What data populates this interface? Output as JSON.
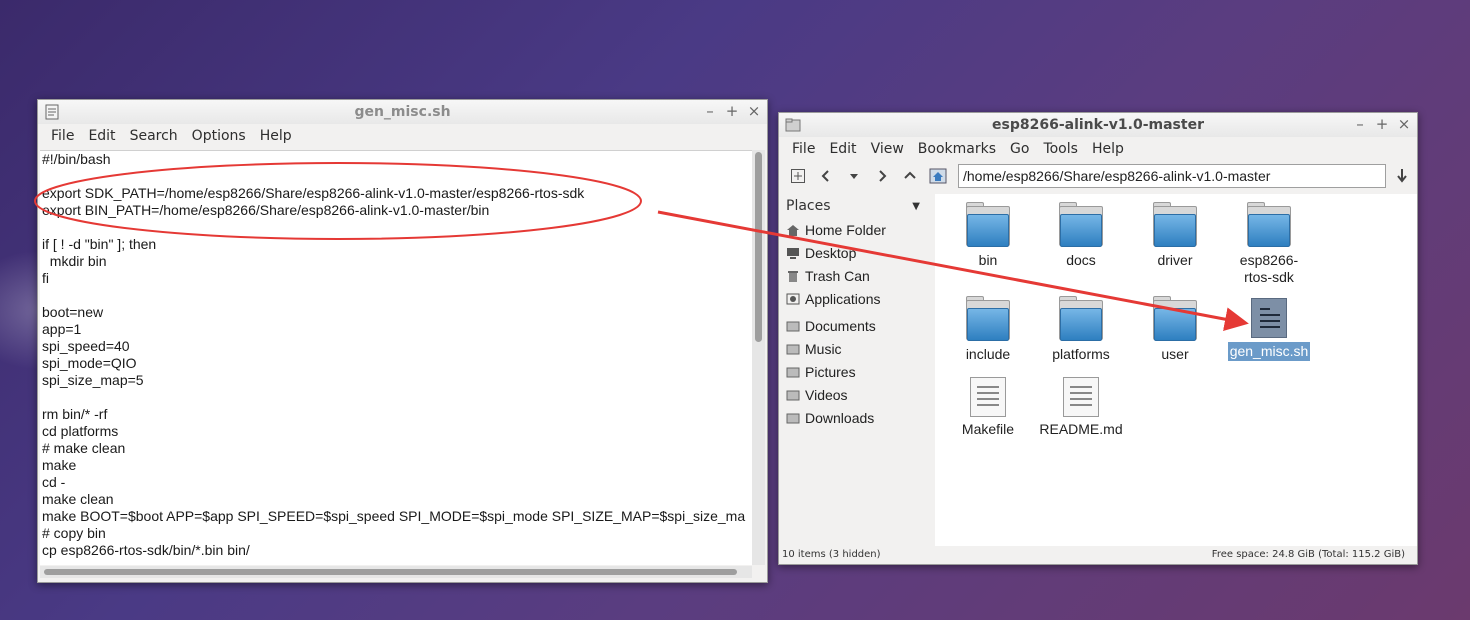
{
  "editor": {
    "title": "gen_misc.sh",
    "menu": [
      "File",
      "Edit",
      "Search",
      "Options",
      "Help"
    ],
    "lines": [
      "#!/bin/bash",
      "",
      "export SDK_PATH=/home/esp8266/Share/esp8266-alink-v1.0-master/esp8266-rtos-sdk",
      "export BIN_PATH=/home/esp8266/Share/esp8266-alink-v1.0-master/bin",
      "",
      "if [ ! -d \"bin\" ]; then",
      "  mkdir bin",
      "fi",
      "",
      "boot=new",
      "app=1",
      "spi_speed=40",
      "spi_mode=QIO",
      "spi_size_map=5",
      "",
      "rm bin/* -rf",
      "cd platforms",
      "# make clean",
      "make",
      "cd -",
      "make clean",
      "make BOOT=$boot APP=$app SPI_SPEED=$spi_speed SPI_MODE=$spi_mode SPI_SIZE_MAP=$spi_size_ma",
      "# copy bin",
      "cp esp8266-rtos-sdk/bin/*.bin bin/"
    ]
  },
  "window_controls": {
    "minimize": "–",
    "maximize": "+",
    "close": "×"
  },
  "file_manager": {
    "title": "esp8266-alink-v1.0-master",
    "menu": [
      "File",
      "Edit",
      "View",
      "Bookmarks",
      "Go",
      "Tools",
      "Help"
    ],
    "path": "/home/esp8266/Share/esp8266-alink-v1.0-master",
    "places_label": "Places",
    "places": [
      "Home Folder",
      "Desktop",
      "Trash Can",
      "Applications"
    ],
    "bookmarks": [
      "Documents",
      "Music",
      "Pictures",
      "Videos",
      "Downloads"
    ],
    "files": {
      "bin": "bin",
      "docs": "docs",
      "driver": "driver",
      "sdk": "esp8266-\nrtos-sdk",
      "include": "include",
      "platforms": "platforms",
      "user": "user",
      "gen_misc": "gen_misc.sh",
      "makefile": "Makefile",
      "readme": "README.md"
    },
    "status_left": "10 items (3 hidden)",
    "status_right": "Free space: 24.8 GiB (Total: 115.2 GiB)"
  },
  "colors": {
    "annotation": "#e53935",
    "selection": "#6b9bc9",
    "folder": "#3a8ed0"
  }
}
